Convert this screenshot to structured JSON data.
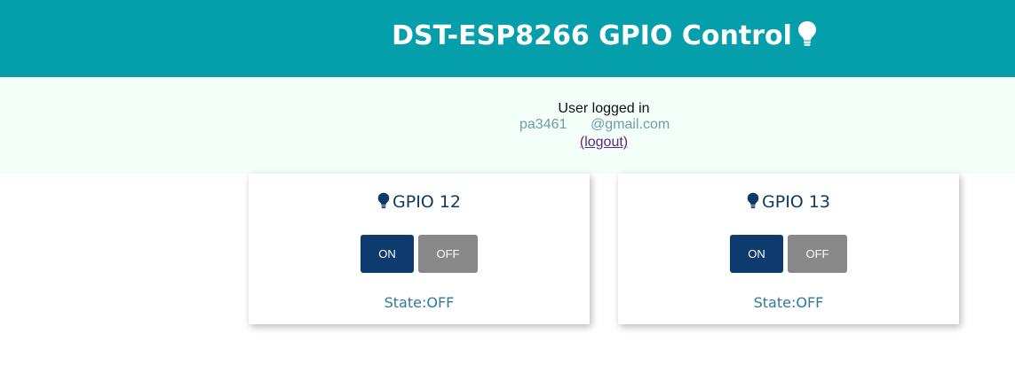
{
  "header": {
    "title": "DST-ESP8266 GPIO Control",
    "icon": "lightbulb-icon",
    "background_color": "#059fab"
  },
  "login": {
    "label": "User logged in",
    "email": "pa3461      @gmail.com",
    "logout_label": "(logout)"
  },
  "cards": [
    {
      "title": "GPIO 12",
      "icon": "lightbulb-icon",
      "on_label": "ON",
      "off_label": "OFF",
      "state_text": "State:OFF"
    },
    {
      "title": "GPIO 13",
      "icon": "lightbulb-icon",
      "on_label": "ON",
      "off_label": "OFF",
      "state_text": "State:OFF"
    }
  ],
  "colors": {
    "accent": "#059fab",
    "on_button": "#0e3b6e",
    "off_button": "#888888",
    "card_title": "#0c3b6b",
    "state_text": "#2e7a9a"
  }
}
